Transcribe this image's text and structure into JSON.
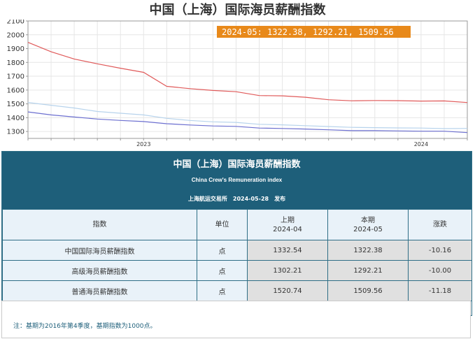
{
  "chart_data": {
    "type": "line",
    "title": "中国（上海）国际海员薪酬指数",
    "x": [
      "2022-10",
      "2022-11",
      "2022-12",
      "2023-01",
      "2023-02",
      "2023-03",
      "2023-04",
      "2023-05",
      "2023-06",
      "2023-07",
      "2023-08",
      "2023-09",
      "2023-10",
      "2023-11",
      "2023-12",
      "2024-01",
      "2024-02",
      "2024-03",
      "2024-04",
      "2024-05"
    ],
    "series": [
      {
        "values": [
          1945,
          1877,
          1825,
          1790,
          1758,
          1728,
          1627,
          1610,
          1597,
          1588,
          1560,
          1558,
          1548,
          1530,
          1522,
          1524,
          1523,
          1520,
          1521,
          1509.56
        ],
        "color": "#e05a5a"
      },
      {
        "values": [
          1510,
          1490,
          1470,
          1445,
          1432,
          1420,
          1395,
          1380,
          1370,
          1366,
          1352,
          1348,
          1342,
          1336,
          1330,
          1328,
          1326,
          1325,
          1320.74,
          1322.38
        ],
        "color": "#b7d3ec"
      },
      {
        "values": [
          1442,
          1420,
          1405,
          1390,
          1380,
          1372,
          1356,
          1347,
          1340,
          1337,
          1325,
          1322,
          1318,
          1312,
          1306,
          1306,
          1304,
          1302,
          1302.21,
          1292.21
        ],
        "color": "#6c6fd0"
      }
    ],
    "ylim": [
      1250,
      2100
    ],
    "yticks": [
      1300,
      1400,
      1500,
      1600,
      1700,
      1800,
      1900,
      2000,
      2100
    ],
    "year_labels": [
      {
        "x": "2023-03",
        "label": "2023"
      },
      {
        "x": "2024-03",
        "label": "2024"
      }
    ],
    "grid": true,
    "annotation": "2024-05: 1322.38, 1292.21, 1509.56",
    "annotation_color": "#e8891a"
  },
  "panel": {
    "title": "中国（上海）国际海员薪酬指数",
    "subtitle": "China Crew's Remuneration index",
    "publish": "上海航运交易所　2024-05-28　发布"
  },
  "table": {
    "headers": {
      "name": "指数",
      "unit": "单位",
      "prev_label": "上期",
      "prev_period": "2024-04",
      "curr_label": "本期",
      "curr_period": "2024-05",
      "change": "涨跌"
    },
    "rows": [
      {
        "name": "中国国际海员薪酬指数",
        "unit": "点",
        "prev": "1332.54",
        "curr": "1322.38",
        "change": "-10.16"
      },
      {
        "name": "高级海员薪酬指数",
        "unit": "点",
        "prev": "1302.21",
        "curr": "1292.21",
        "change": "-10.00"
      },
      {
        "name": "普通海员薪酬指数",
        "unit": "点",
        "prev": "1520.74",
        "curr": "1509.56",
        "change": "-11.18"
      }
    ]
  },
  "note": "注：基期为2016年第4季度，基期指数为1000点。"
}
